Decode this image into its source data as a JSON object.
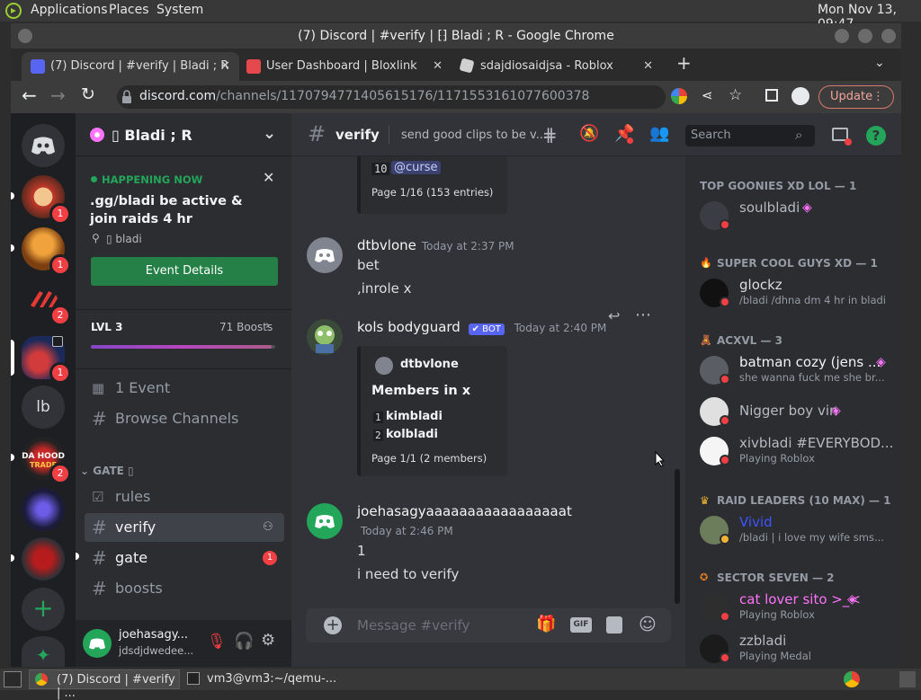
{
  "panel": {
    "applications": "Applications",
    "places": "Places",
    "system": "System",
    "clock": "Mon Nov 13, 09:47"
  },
  "window": {
    "title": "(7) Discord | #verify | ⁅⁆ Bladi ; R - Google Chrome"
  },
  "tabs": [
    {
      "label": "(7) Discord | #verify |     Bladi ; R",
      "color": "#5865f2"
    },
    {
      "label": "User Dashboard | Bloxlink",
      "color": "#e5484d"
    },
    {
      "label": "sdajdiosaidjsa - Roblox",
      "color": "#d0d0d0"
    }
  ],
  "address": {
    "domain": "discord.com",
    "path": "/channels/1170794771405615176/1171553161077600378",
    "update": "Update"
  },
  "server": {
    "name": "▯ Bladi ; R",
    "event": {
      "status": "HAPPENING NOW",
      "title": ".gg/bladi be active & join raids 4 hr",
      "location": "▯ bladi",
      "button": "Event Details"
    },
    "boost": {
      "level": "LVL 3",
      "count": "71 Boosts",
      "progress": 0.98
    },
    "events_label": "1 Event",
    "browse_label": "Browse Channels",
    "category": "GATE ▯",
    "channels": [
      {
        "name": "rules"
      },
      {
        "name": "verify"
      },
      {
        "name": "gate",
        "badge": "1"
      },
      {
        "name": "boosts"
      }
    ]
  },
  "guild_badges": [
    "1",
    "1",
    "2",
    "1",
    "2"
  ],
  "guild_lb": "lb",
  "user": {
    "name": "joehasagy...",
    "status": "jdsdjdwedee..."
  },
  "chat": {
    "channel": "verify",
    "topic": "send good clips to be v...",
    "search_placeholder": "Search",
    "top_embed": {
      "line_num": "10",
      "line_text": "@curse",
      "footer": "Page 1/16 (153 entries)"
    },
    "messages": [
      {
        "author": "dtbvlone",
        "time": "Today at 2:37 PM",
        "lines": [
          "bet",
          ",inrole x"
        ]
      },
      {
        "author": "kols bodyguard",
        "bot": "BOT",
        "time": "Today at 2:40 PM",
        "embed": {
          "author": "dtbvlone",
          "title": "Members in x",
          "rows": [
            {
              "n": "1",
              "v": "kimbladi"
            },
            {
              "n": "2",
              "v": "kolbladi"
            }
          ],
          "footer": "Page 1/1 (2 members)"
        }
      },
      {
        "author": "joehasagyaaaaaaaaaaaaaaaaat",
        "time": "Today at 2:46 PM",
        "lines": [
          "1",
          "i need to  verify"
        ]
      }
    ],
    "composer_placeholder": "Message #verify",
    "gif": "GIF"
  },
  "members": {
    "sections": [
      {
        "title": "TOP GOONIES XD LOL — 1",
        "items": [
          {
            "name": "soulbladi",
            "sub": ""
          }
        ]
      },
      {
        "title": "SUPER COOL GUYS XD — 1",
        "items": [
          {
            "name": "glockz",
            "sub": "/bladi /dhna dm 4 hr in bladi"
          }
        ]
      },
      {
        "title": "ACXVL — 3",
        "items": [
          {
            "name": "batman cozy (jens ...",
            "sub": "she wanna fuck me she br..."
          },
          {
            "name": "Nigger boy vin",
            "sub": ""
          },
          {
            "name": "xivbladi #EVERYBOD...",
            "sub": "Playing Roblox"
          }
        ]
      },
      {
        "title": "RAID LEADERS (10 MAX) — 1",
        "items": [
          {
            "name": "Vivid",
            "sub": "/bladi | i love my wife sms..."
          }
        ]
      },
      {
        "title": "SECTOR SEVEN — 2",
        "items": [
          {
            "name": "cat lover sito >_<",
            "sub": "Playing Roblox"
          },
          {
            "name": "zzbladi",
            "sub": "Playing Medal"
          }
        ]
      }
    ]
  },
  "taskbar": {
    "chrome": "(7) Discord | #verify | ...",
    "terminal": "vm3@vm3:~/qemu-..."
  }
}
